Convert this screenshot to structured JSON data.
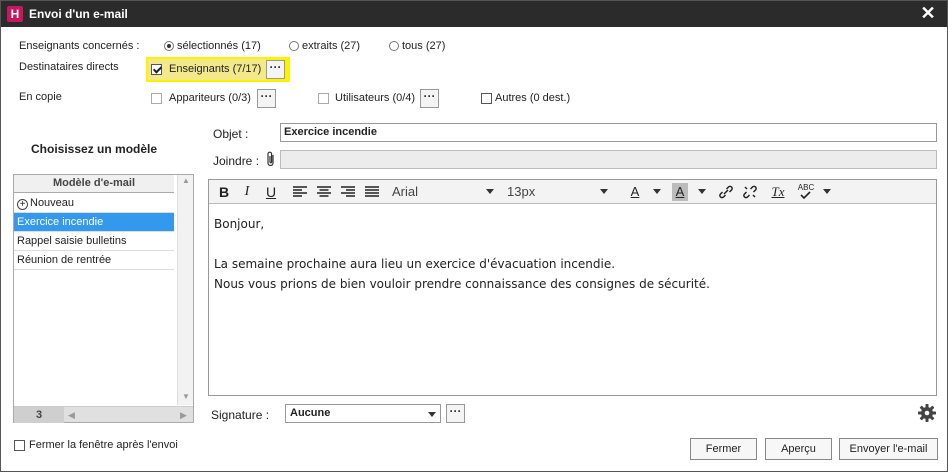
{
  "window": {
    "title": "Envoi d'un e-mail",
    "app_letter": "H"
  },
  "teachers": {
    "label": "Enseignants concernés :",
    "options": [
      "sélectionnés (17)",
      "extraits (27)",
      "tous (27)"
    ]
  },
  "direct": {
    "label": "Destinataires directs",
    "teachers": "Enseignants (7/17)"
  },
  "copy": {
    "label": "En copie",
    "appariteurs": "Appariteurs (0/3)",
    "utilisateurs": "Utilisateurs (0/4)",
    "autres": "Autres (0 dest.)"
  },
  "dots": "···",
  "templates": {
    "title": "Choisissez un modèle",
    "header": "Modèle d'e-mail",
    "new_label": "Nouveau",
    "items": [
      "Exercice incendie",
      "Rappel saisie bulletins",
      "Réunion de rentrée"
    ],
    "count": "3"
  },
  "subject": {
    "label": "Objet :",
    "value": "Exercice incendie"
  },
  "attach": {
    "label": "Joindre :"
  },
  "toolbar": {
    "bold": "B",
    "italic": "I",
    "underline": "U",
    "font": "Arial",
    "size": "13px",
    "font_color": "A",
    "bg_color": "A",
    "clear_format": "Tx",
    "spell": "ABC"
  },
  "body": {
    "lines": [
      "Bonjour,",
      "",
      "La semaine prochaine aura lieu un exercice d'évacuation incendie.",
      "Nous vous prions de bien vouloir prendre connaissance des consignes de sécurité."
    ]
  },
  "signature": {
    "label": "Signature :",
    "value": "Aucune"
  },
  "footer": {
    "close_after": "Fermer la fenêtre après l'envoi",
    "close": "Fermer",
    "preview": "Aperçu",
    "send": "Envoyer l'e-mail"
  },
  "colors": {
    "accent": "#3399ee",
    "highlight": "#fff200",
    "brand": "#c8175f"
  }
}
